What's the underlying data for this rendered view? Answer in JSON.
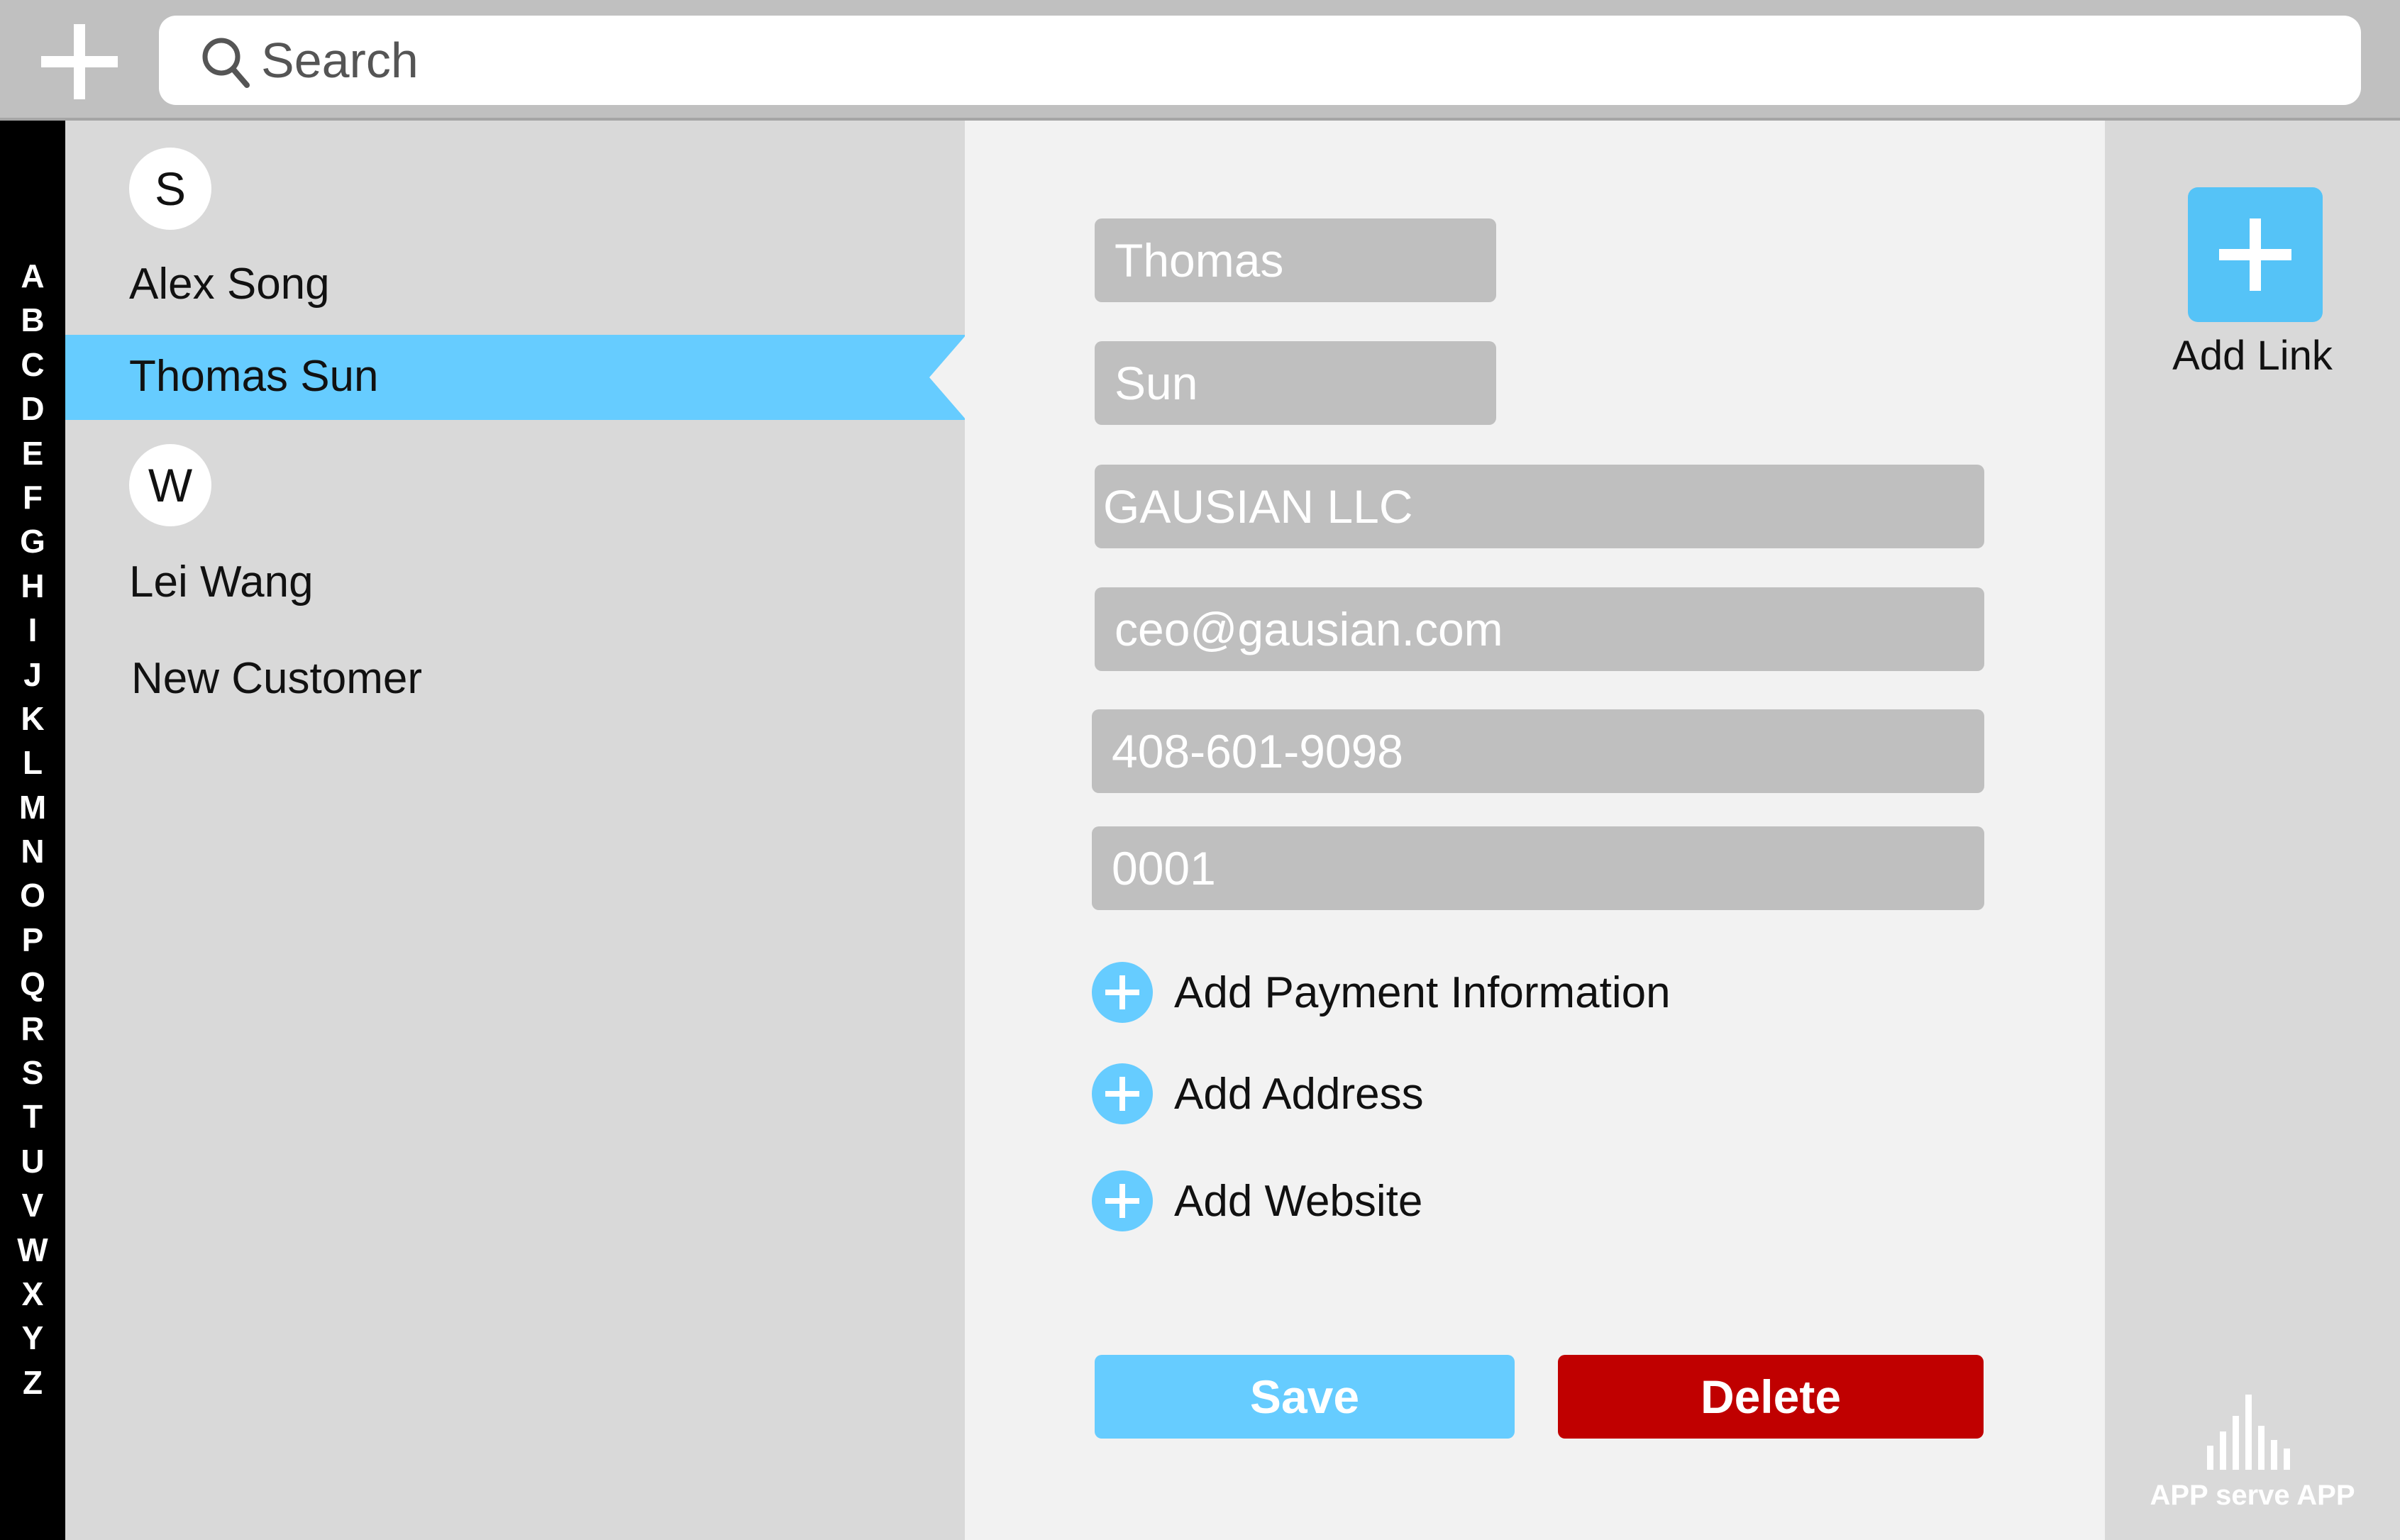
{
  "header": {
    "search_placeholder": "Search"
  },
  "alphabet": [
    "A",
    "B",
    "C",
    "D",
    "E",
    "F",
    "G",
    "H",
    "I",
    "J",
    "K",
    "L",
    "M",
    "N",
    "O",
    "P",
    "Q",
    "R",
    "S",
    "T",
    "U",
    "V",
    "W",
    "X",
    "Y",
    "Z"
  ],
  "contacts": {
    "section_s": "S",
    "section_w": "W",
    "alex": "Alex Song",
    "thomas": "Thomas Sun",
    "lei": "Lei Wang",
    "new_customer": "New Customer"
  },
  "form": {
    "first_name": "Thomas",
    "last_name": "Sun",
    "company": "GAUSIAN LLC",
    "email": "ceo@gausian.com",
    "phone": "408-601-9098",
    "id": "0001",
    "add_payment": "Add Payment Information",
    "add_address": "Add Address",
    "add_website": "Add Website",
    "save": "Save",
    "delete": "Delete"
  },
  "right_panel": {
    "add_link": "Add Link",
    "brand": "APP serve APP"
  },
  "colors": {
    "accent": "#66ccff",
    "danger": "#c00000",
    "field": "#bfbfbf"
  }
}
